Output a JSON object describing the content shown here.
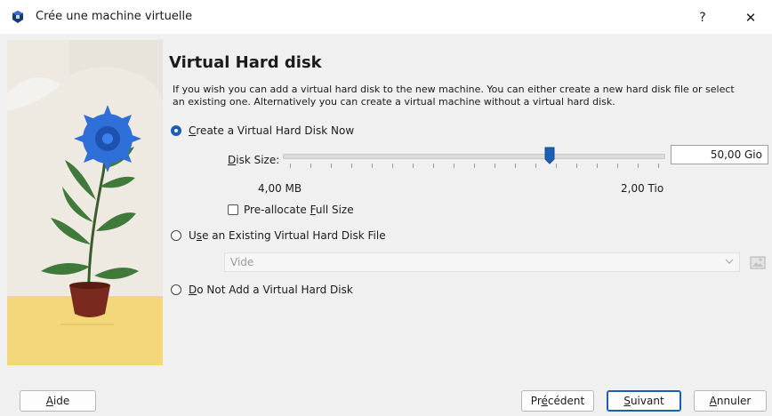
{
  "window": {
    "title": "Crée une machine virtuelle",
    "help_label": "?",
    "close_label": "✕"
  },
  "page": {
    "heading": "Virtual Hard disk",
    "description": "If you wish you can add a virtual hard disk to the new machine. You can either create a new hard disk file or select an existing one. Alternatively you can create a virtual machine without a virtual hard disk."
  },
  "options": {
    "create_now": {
      "label_mnemonic": "C",
      "label_rest": "reate a Virtual Hard Disk Now",
      "checked": true
    },
    "use_existing": {
      "label_prefix": "U",
      "label_mnemonic": "s",
      "label_rest": "e an Existing Virtual Hard Disk File",
      "checked": false
    },
    "do_not_add": {
      "label_mnemonic": "D",
      "label_rest": "o Not Add a Virtual Hard Disk",
      "checked": false
    }
  },
  "disk_size": {
    "label_mnemonic": "D",
    "label_rest": "isk Size:",
    "value": "50,00 Gio",
    "min_label": "4,00 MB",
    "max_label": "2,00 Tio",
    "slider_fraction": 0.7
  },
  "preallocate": {
    "label_prefix": "Pre-allocate ",
    "label_mnemonic": "F",
    "label_rest": "ull Size",
    "checked": false
  },
  "existing_file": {
    "selected": "Vide"
  },
  "buttons": {
    "help": {
      "mnemonic": "A",
      "rest": "ide"
    },
    "back": {
      "prefix": "Pr",
      "mnemonic": "é",
      "rest": "cédent"
    },
    "next": {
      "mnemonic": "S",
      "rest": "uivant"
    },
    "cancel": {
      "mnemonic": "A",
      "rest": "nnuler"
    }
  },
  "colors": {
    "accent": "#1a5fb4",
    "background": "#f0f0f0",
    "flower": "#2f6fd8",
    "pot": "#7a2a1c",
    "floor": "#f3d77a"
  }
}
